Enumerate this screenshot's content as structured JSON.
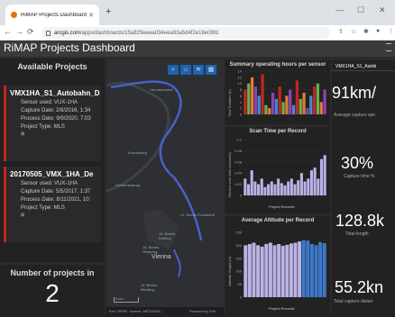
{
  "browser": {
    "tab_title": "RiMAP Projects Dashboard",
    "url_host": "arcgis.com",
    "url_path": "/apps/dashboards/15a829eeea034eea93a5d4f2e18e09fd"
  },
  "app": {
    "title": "RiMAP Projects Dashboard"
  },
  "projects_panel": {
    "title": "Available Projects",
    "projects": [
      {
        "name": "VMX1HA_S1_Autobahn_D",
        "sensor": "Sensor used: VUX-1HA",
        "capture": "Capture Date: 2/8/2016, 1:34",
        "process": "Process Date: 9/9/2020, 7:03",
        "type": "Project Type: MLS"
      },
      {
        "name": "20170505_VMX_1HA_De",
        "sensor": "Sensor used: VUX-1HA",
        "capture": "Capture Date: 5/5/2017, 1:37",
        "process": "Process Date: 8/11/2021, 10:",
        "type": "Project Type: MLS"
      }
    ]
  },
  "count_panel": {
    "title": "Number of projects in",
    "value": "2"
  },
  "map": {
    "labels": [
      "Hermannsdorf",
      "Korneuburg",
      "Klosterneuburg",
      "21. Bezirk-Floridsdorf",
      "19. Bezirk-Döbling",
      "16. Bezirk-Ottakring",
      "Vienna",
      "12. Bezirk-Meidling"
    ],
    "scale": "6 km",
    "attribution": "Esri, HERE, Garmin, METI/NAS...",
    "powered": "Powered by Esri"
  },
  "charts": {
    "hours_title": "Summary operating hours per sensor",
    "hours_ylabel": "Total Duration (h)",
    "scan_title": "Scan Time per Record",
    "scan_ylabel": "Record scan time (seconds)",
    "scan_xlabel": "Project Records",
    "alt_title": "Average Altitude per Record",
    "alt_ylabel": "Altitude Height (m)",
    "alt_xlabel": "Project Records"
  },
  "chart_data": [
    {
      "type": "bar",
      "title": "Summary operating hours per sensor",
      "ylabel": "Total Duration (h)",
      "yticks": [
        "14",
        "12",
        "10",
        "8",
        "6",
        "4",
        "2",
        "0"
      ],
      "ylim": [
        0,
        14
      ],
      "values": [
        8,
        10,
        12,
        9,
        6,
        13,
        3,
        2,
        7,
        5,
        9,
        4,
        6,
        8,
        3,
        11,
        5,
        7,
        2,
        6,
        9,
        10,
        4,
        8
      ],
      "colors": [
        "#c0281f",
        "#6ab04c",
        "#e07b39",
        "#8e44ad",
        "#3d8bd6"
      ]
    },
    {
      "type": "bar",
      "title": "Scan Time per Record",
      "ylabel": "Record scan time (seconds)",
      "xlabel": "Project Records",
      "yticks": [
        "0.1",
        "0.08",
        "0.06",
        "0.04",
        "0.02",
        "0"
      ],
      "ylim": [
        0,
        0.1
      ],
      "values": [
        0.03,
        0.02,
        0.045,
        0.025,
        0.02,
        0.03,
        0.015,
        0.02,
        0.025,
        0.02,
        0.03,
        0.022,
        0.018,
        0.025,
        0.03,
        0.02,
        0.027,
        0.04,
        0.025,
        0.03,
        0.045,
        0.05,
        0.03,
        0.065,
        0.072
      ]
    },
    {
      "type": "bar",
      "title": "Average Altitude per Record",
      "ylabel": "Altitude Height (m)",
      "xlabel": "Project Records",
      "yticks": [
        "250",
        "200",
        "150",
        "100",
        "50",
        "0"
      ],
      "ylim": [
        0,
        250
      ],
      "values": [
        200,
        205,
        210,
        200,
        195,
        205,
        210,
        200,
        205,
        198,
        202,
        207,
        210,
        215,
        220,
        218,
        205,
        200,
        212,
        208
      ]
    }
  ],
  "side_stats": {
    "header": "VMX1HA_S1_Autob",
    "stats": [
      {
        "value": "91km/",
        "label": "Average capture spe"
      },
      {
        "value": "30%",
        "label": "Capture time %"
      },
      {
        "value": "128.8k",
        "label": "Total length"
      },
      {
        "value": "55.2kn",
        "label": "Total capture distan"
      }
    ]
  }
}
